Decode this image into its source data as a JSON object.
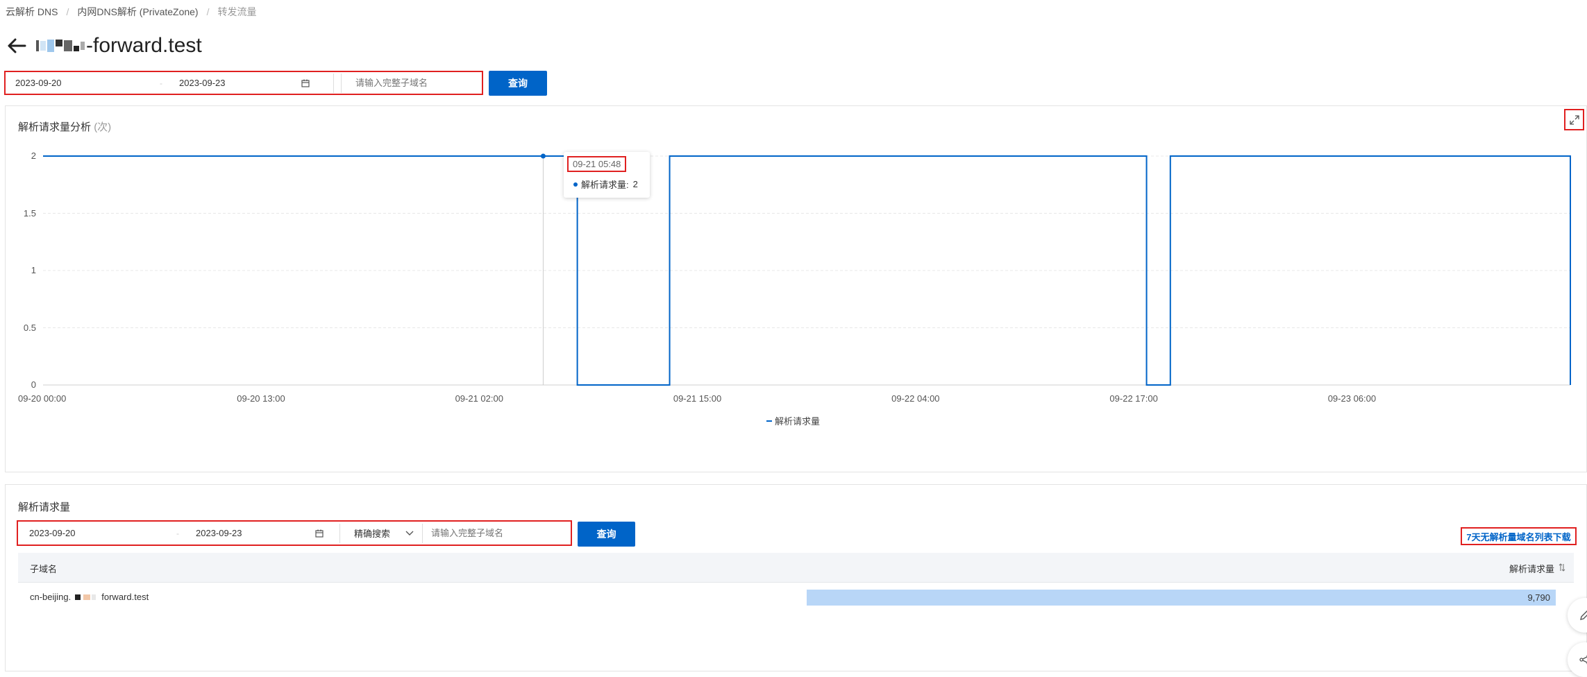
{
  "breadcrumb": {
    "items": [
      "云解析 DNS",
      "内网DNS解析 (PrivateZone)",
      "转发流量"
    ]
  },
  "header": {
    "title": "-forward.test"
  },
  "filter_top": {
    "date_start": "2023-09-20",
    "date_end": "2023-09-23",
    "subdomain_placeholder": "请输入完整子域名",
    "query_label": "查询"
  },
  "chart": {
    "title": "解析请求量分析",
    "unit": "(次)",
    "tooltip": {
      "time": "09-21 05:48",
      "series_label": "解析请求量:",
      "value": "2"
    }
  },
  "chart_data": {
    "type": "line",
    "step": true,
    "x_tick_labels": [
      "09-20 00:00",
      "09-20 13:00",
      "09-21 02:00",
      "09-21 15:00",
      "09-22 04:00",
      "09-22 17:00",
      "09-23 06:00"
    ],
    "y_tick_labels": [
      "0",
      "0.5",
      "1",
      "1.5",
      "2"
    ],
    "ylim": [
      0,
      2
    ],
    "xlim": [
      "09-20 00:00",
      "09-23 19:00"
    ],
    "series": [
      {
        "name": "解析请求量",
        "color": "#0064c8",
        "points": [
          [
            "09-20 00:00",
            2
          ],
          [
            "09-21 07:50",
            2
          ],
          [
            "09-21 07:50",
            0
          ],
          [
            "09-21 13:20",
            0
          ],
          [
            "09-21 13:20",
            2
          ],
          [
            "09-22 17:45",
            2
          ],
          [
            "09-22 17:45",
            0
          ],
          [
            "09-22 19:10",
            0
          ],
          [
            "09-22 19:10",
            2
          ],
          [
            "09-23 19:00",
            2
          ],
          [
            "09-23 19:00",
            0
          ]
        ]
      }
    ],
    "grid": true,
    "legend_position": "bottom-center"
  },
  "table_section": {
    "title": "解析请求量",
    "date_start": "2023-09-20",
    "date_end": "2023-09-23",
    "search_mode": "精确搜索",
    "subdomain_placeholder": "请输入完整子域名",
    "query_label": "查询",
    "download_label": "7天无解析量域名列表下载",
    "columns": [
      "子域名",
      "解析请求量"
    ],
    "rows": [
      {
        "name_prefix": "cn-beijing.",
        "name_suffix": "forward.test",
        "count": "9,790",
        "fraction": 1.0
      }
    ]
  },
  "colors": {
    "primary": "#0064c8",
    "highlight": "#e02020",
    "bar": "#b8d6f7"
  }
}
